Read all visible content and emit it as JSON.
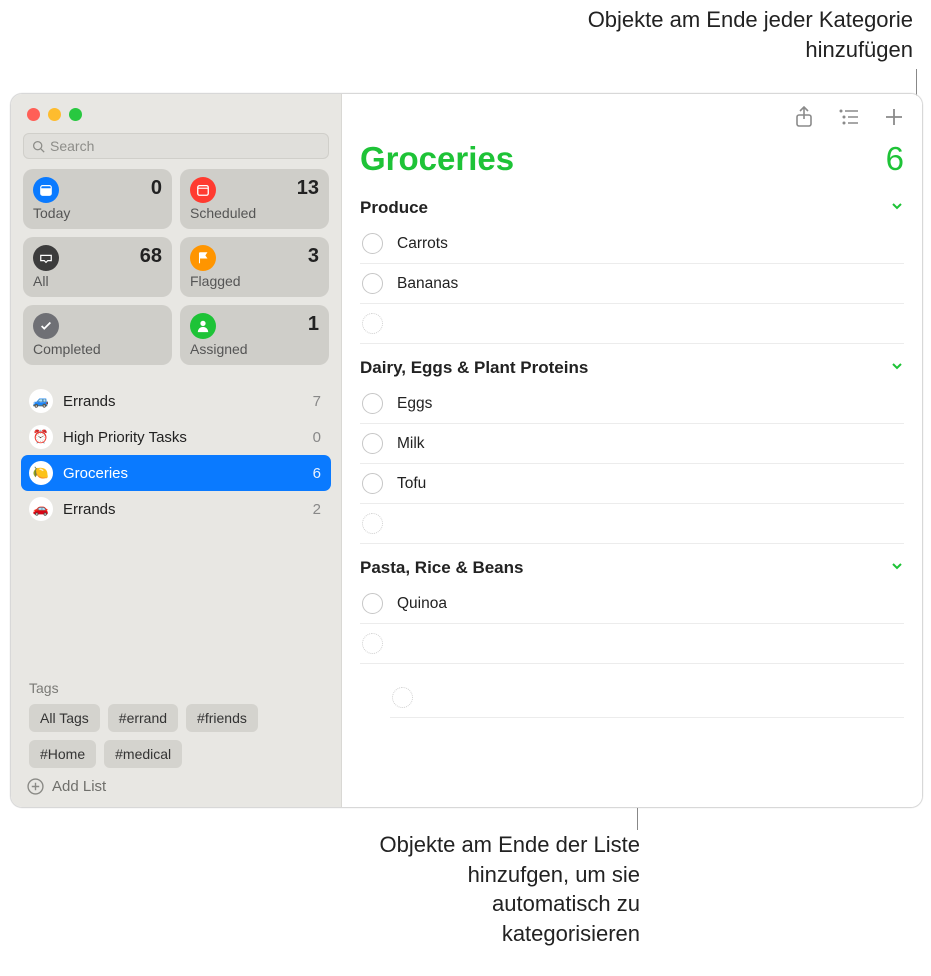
{
  "annotations": {
    "top": "Objekte am Ende jeder Kategorie hinzufügen",
    "bottom": "Objekte am Ende der Liste hinzufgen, um sie automatisch zu kategorisieren"
  },
  "search": {
    "placeholder": "Search"
  },
  "smart_lists": {
    "today": {
      "label": "Today",
      "count": "0",
      "color": "#0a7aff"
    },
    "scheduled": {
      "label": "Scheduled",
      "count": "13",
      "color": "#ff3b30"
    },
    "all": {
      "label": "All",
      "count": "68",
      "color": "#3c3c3c"
    },
    "flagged": {
      "label": "Flagged",
      "count": "3",
      "color": "#ff9500"
    },
    "completed": {
      "label": "Completed",
      "count": "",
      "color": "#6f7075"
    },
    "assigned": {
      "label": "Assigned",
      "count": "1",
      "color": "#1ec337"
    }
  },
  "lists": [
    {
      "name": "Errands",
      "count": "7",
      "emoji": "🚙",
      "selected": false
    },
    {
      "name": "High Priority Tasks",
      "count": "0",
      "emoji": "⏰",
      "selected": false
    },
    {
      "name": "Groceries",
      "count": "6",
      "emoji": "🍋",
      "selected": true
    },
    {
      "name": "Errands",
      "count": "2",
      "emoji": "🚗",
      "selected": false
    }
  ],
  "tags_title": "Tags",
  "tags": [
    "All Tags",
    "#errand",
    "#friends",
    "#Home",
    "#medical"
  ],
  "add_list_label": "Add List",
  "main": {
    "title": "Groceries",
    "count": "6",
    "sections": [
      {
        "title": "Produce",
        "items": [
          "Carrots",
          "Bananas"
        ]
      },
      {
        "title": "Dairy, Eggs & Plant Proteins",
        "items": [
          "Eggs",
          "Milk",
          "Tofu"
        ]
      },
      {
        "title": "Pasta, Rice & Beans",
        "items": [
          "Quinoa"
        ]
      }
    ]
  }
}
